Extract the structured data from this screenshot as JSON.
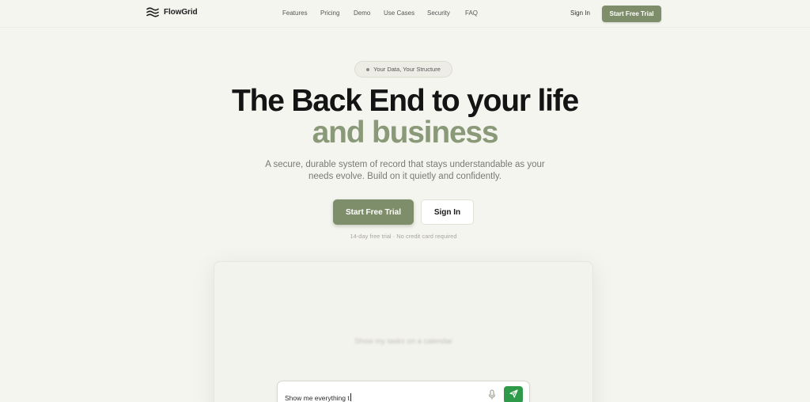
{
  "nav": {
    "brand": "FlowGrid",
    "links": [
      "Features",
      "Pricing",
      "Demo",
      "Use Cases",
      "Security",
      "FAQ"
    ],
    "signin": "Sign In",
    "cta": "Start Free Trial"
  },
  "hero": {
    "badge": "Your Data, Your Structure",
    "title_line1": "The Back End to your life",
    "title_line2": "and business",
    "subtitle_line1": "A secure, durable system of record that stays understandable as your",
    "subtitle_line2": "needs evolve. Build on it quietly and confidently.",
    "primary_button": "Start Free Trial",
    "secondary_button": "Sign In",
    "note": "14-day free trial · No credit card required"
  },
  "demo": {
    "ghost_prompt": "Show my tasks on a calendar",
    "input_value": "Show me everything t"
  },
  "colors": {
    "accent": "#7f8e6a",
    "accent_light": "#8a9978",
    "send": "#2f9a4a",
    "background": "#f5f5ef"
  }
}
